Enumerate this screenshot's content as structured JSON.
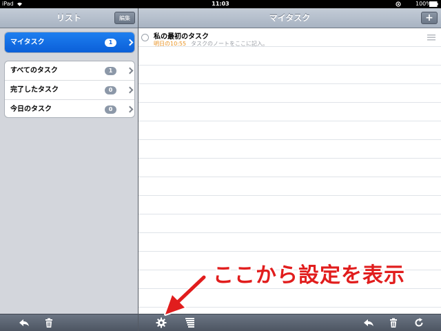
{
  "statusbar": {
    "carrier": "iPad",
    "time": "11:03",
    "battery": "100%"
  },
  "left": {
    "title": "リスト",
    "edit_label": "編集",
    "primary": [
      {
        "label": "マイタスク",
        "count": "1"
      }
    ],
    "filters": [
      {
        "label": "すべてのタスク",
        "count": "1"
      },
      {
        "label": "完了したタスク",
        "count": "0"
      },
      {
        "label": "今日のタスク",
        "count": "0"
      }
    ]
  },
  "right": {
    "title": "マイタスク",
    "add_label": "+",
    "tasks": [
      {
        "title": "私の最初のタスク",
        "due": "明日の10:55",
        "note": "タスクのノートをここに記入。"
      }
    ]
  },
  "annotation": {
    "text": "ここから設定を表示"
  },
  "icons": {
    "left_toolbar": [
      "reply-icon",
      "trash-icon"
    ],
    "right_toolbar": [
      "gear-icon",
      "stack-icon",
      "reply-icon",
      "trash-icon",
      "refresh-icon"
    ]
  },
  "colors": {
    "selected_row": "#1469e0",
    "due_text": "#e8901e",
    "annotation": "#e11d1d"
  }
}
